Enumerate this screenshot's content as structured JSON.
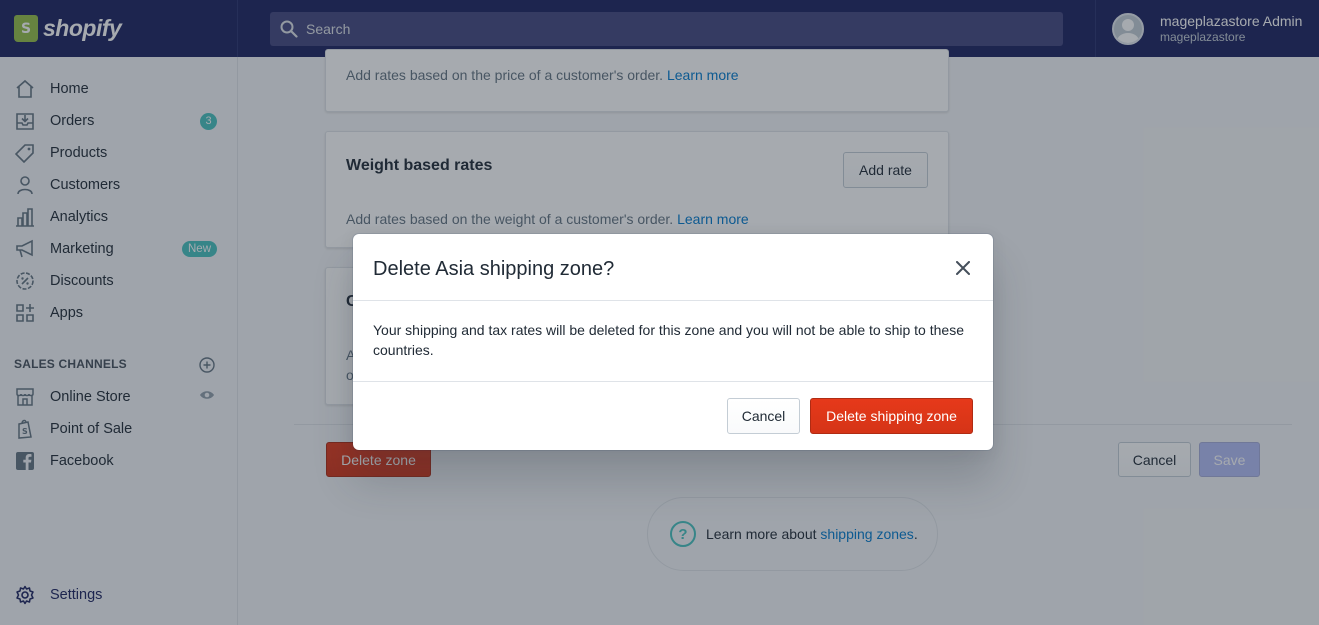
{
  "topbar": {
    "brand": "shopify",
    "search_placeholder": "Search",
    "account_name": "mageplazastore Admin",
    "account_store": "mageplazastore"
  },
  "sidebar": {
    "items": [
      {
        "label": "Home",
        "icon": "home-icon"
      },
      {
        "label": "Orders",
        "icon": "orders-icon",
        "badge": "3"
      },
      {
        "label": "Products",
        "icon": "tag-icon"
      },
      {
        "label": "Customers",
        "icon": "person-icon"
      },
      {
        "label": "Analytics",
        "icon": "bar-chart-icon"
      },
      {
        "label": "Marketing",
        "icon": "megaphone-icon",
        "badge": "New"
      },
      {
        "label": "Discounts",
        "icon": "discount-icon"
      },
      {
        "label": "Apps",
        "icon": "apps-icon"
      }
    ],
    "sales_channels_title": "SALES CHANNELS",
    "channels": [
      {
        "label": "Online Store",
        "icon": "store-icon"
      },
      {
        "label": "Point of Sale",
        "icon": "pos-bag-icon"
      },
      {
        "label": "Facebook",
        "icon": "facebook-icon"
      }
    ],
    "settings_label": "Settings"
  },
  "main": {
    "price_card_text": "Add rates based on the price of a customer's order.",
    "learn_more": "Learn more",
    "weight_card_title": "Weight based rates",
    "add_rate_label": "Add rate",
    "weight_card_text": "Add rates based on the weight of a customer's order.",
    "third_card_letter": "C",
    "third_card_line1": "A",
    "third_card_line2": "o",
    "delete_zone_label": "Delete zone",
    "cancel_label": "Cancel",
    "save_label": "Save",
    "help_prefix": "Learn more about ",
    "help_link": "shipping zones",
    "help_suffix": "."
  },
  "modal": {
    "title": "Delete Asia shipping zone?",
    "body": "Your shipping and tax rates will be deleted for this zone and you will not be able to ship to these countries.",
    "cancel_label": "Cancel",
    "confirm_label": "Delete shipping zone"
  },
  "colors": {
    "topbar": "#1c2260",
    "accent_teal": "#47c1bf",
    "danger": "#de3618",
    "link": "#007ace"
  }
}
